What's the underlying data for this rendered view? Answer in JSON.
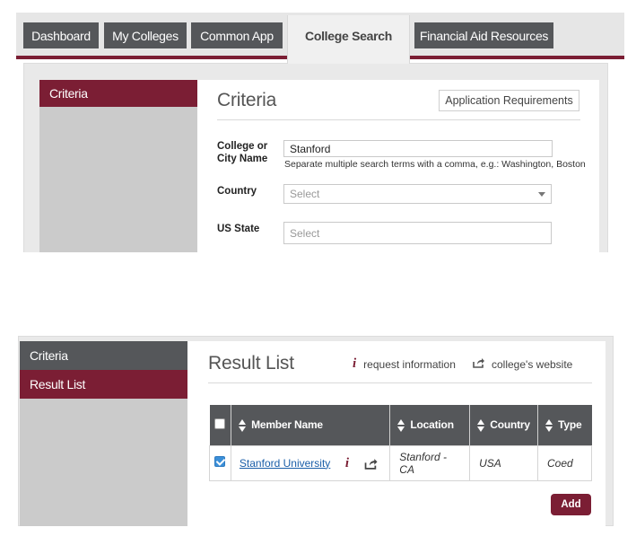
{
  "nav": {
    "tabs": [
      {
        "label": "Dashboard"
      },
      {
        "label": "My Colleges"
      },
      {
        "label": "Common App"
      },
      {
        "label": "College Search"
      },
      {
        "label": "Financial Aid Resources"
      }
    ]
  },
  "criteria_panel": {
    "sidebar_label": "Criteria",
    "title": "Criteria",
    "app_req_button": "Application Requirements",
    "college_label": "College or City Name",
    "college_value": "Stanford",
    "college_hint": "Separate multiple search terms with a comma, e.g.: Washington, Boston",
    "country_label": "Country",
    "country_placeholder": "Select",
    "state_label": "US State",
    "state_placeholder": "Select"
  },
  "result_panel": {
    "sidebar_items": [
      {
        "label": "Criteria"
      },
      {
        "label": "Result List"
      }
    ],
    "title": "Result List",
    "request_info_label": "request information",
    "website_label": "college's website",
    "columns": [
      "Member Name",
      "Location",
      "Country",
      "Type"
    ],
    "rows": [
      {
        "checked": true,
        "name": "Stanford University",
        "location": "Stanford - CA",
        "country": "USA",
        "type": "Coed"
      }
    ],
    "add_button": "Add"
  },
  "colors": {
    "accent": "#7b1e34",
    "tab_dark": "#55575a",
    "link": "#1a5ea8"
  },
  "icons": [
    "info-icon",
    "share-icon",
    "sort-icon",
    "dropdown-caret-icon",
    "checkbox-icon"
  ]
}
